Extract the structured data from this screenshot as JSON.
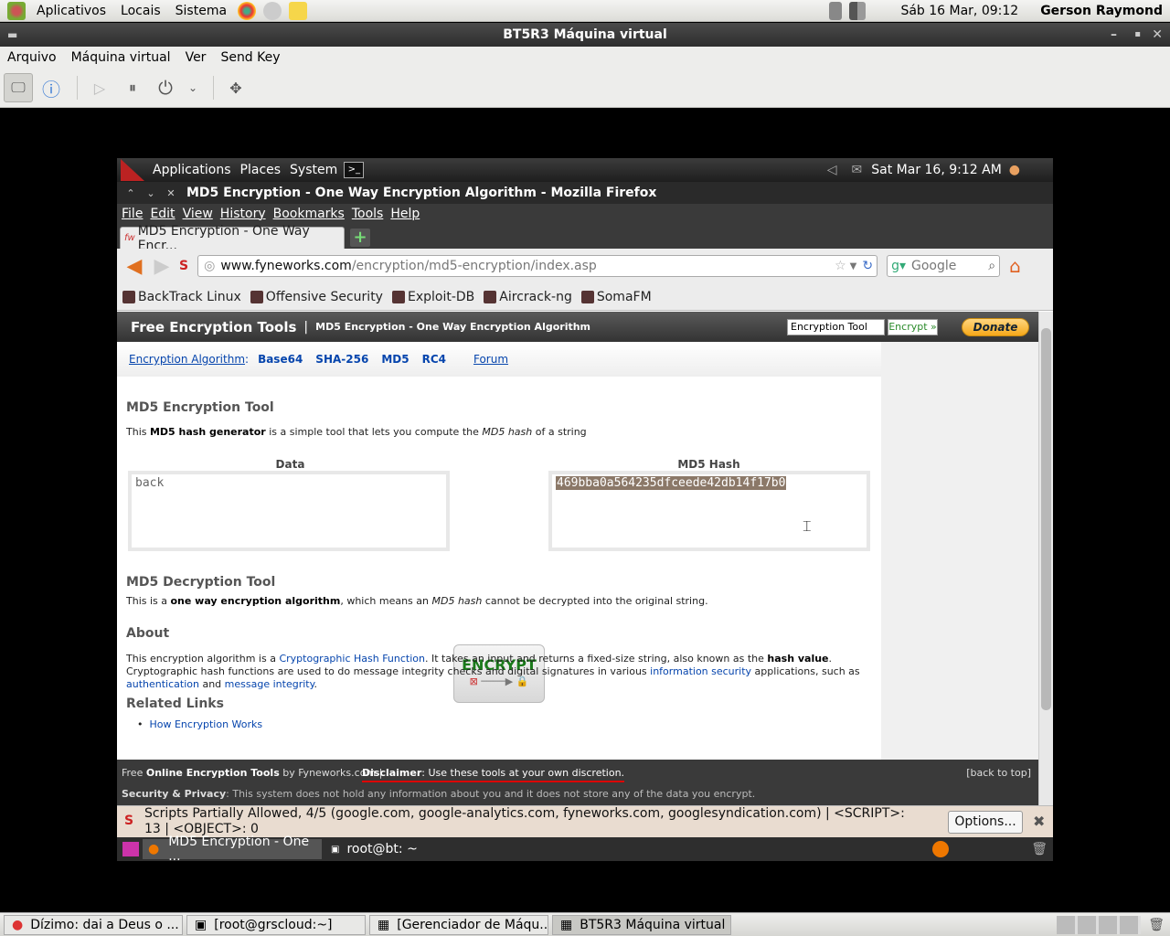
{
  "host_panel": {
    "menus": [
      "Aplicativos",
      "Locais",
      "Sistema"
    ],
    "clock": "Sáb 16 Mar, 09:12",
    "user": "Gerson Raymond"
  },
  "vbox": {
    "title": "BT5R3 Máquina virtual",
    "menus": [
      "Arquivo",
      "Máquina virtual",
      "Ver",
      "Send Key"
    ]
  },
  "guest_panel": {
    "menus": [
      "Applications",
      "Places",
      "System"
    ],
    "clock": "Sat Mar 16,  9:12 AM"
  },
  "firefox": {
    "window_title": "MD5 Encryption - One Way Encryption Algorithm - Mozilla Firefox",
    "menus": [
      "File",
      "Edit",
      "View",
      "History",
      "Bookmarks",
      "Tools",
      "Help"
    ],
    "tab_title": "MD5 Encryption - One Way Encr...",
    "url_domain": "www.fyneworks.com",
    "url_path": "/encryption/md5-encryption/index.asp",
    "search_placeholder": "Google",
    "bookmarks": [
      "BackTrack Linux",
      "Offensive Security",
      "Exploit-DB",
      "Aircrack-ng",
      "SomaFM"
    ]
  },
  "site": {
    "brand": "Free Encryption Tools",
    "divider": "|",
    "subtitle": "MD5 Encryption - One Way Encryption Algorithm",
    "search_value": "Encryption Tool",
    "encrypt_link": "Encrypt »",
    "donate": "Donate",
    "alg_label": "Encryption Algorithm",
    "alg_colon": ":",
    "algorithms": [
      "Base64",
      "SHA-256",
      "MD5",
      "RC4"
    ],
    "forum": "Forum",
    "tool_title": "MD5 Encryption Tool",
    "tool_desc_1": "This ",
    "tool_desc_b": "MD5 hash generator",
    "tool_desc_2": " is a simple tool that lets you compute the ",
    "tool_desc_i": "MD5 hash",
    "tool_desc_3": " of a string",
    "data_label": "Data",
    "data_value": "back",
    "hash_label": "MD5 Hash",
    "hash_value": "469bba0a564235dfceede42db14f17b0",
    "encrypt_button": "ENCRYPT",
    "decrypt_title": "MD5 Decryption Tool",
    "decrypt_1": "This is a ",
    "decrypt_b": "one way encryption algorithm",
    "decrypt_2": ", which means an ",
    "decrypt_i": "MD5 hash",
    "decrypt_3": " cannot be decrypted into the original string.",
    "about_title": "About",
    "about_1": "This encryption algorithm is a ",
    "about_link1": "Cryptographic Hash Function",
    "about_2": ". It takes an input and returns a fixed-size string, also known as the ",
    "about_b": "hash value",
    "about_3": ". Cryptographic hash functions are used to do message integrity checks and digital signatures in various ",
    "about_link2": "information security",
    "about_4": " applications, such as ",
    "about_link3": "authentication",
    "about_5": " and ",
    "about_link4": "message integrity",
    "about_6": ".",
    "related_title": "Related Links",
    "related_link": "How Encryption Works",
    "foot_free": "Free ",
    "foot_b": "Online Encryption Tools",
    "foot_by": " by Fyneworks.com |",
    "foot_disc_b": "Disclaimer",
    "foot_disc": ": Use these tools at your own discretion.",
    "foot_top": "[back to top]",
    "foot_sec_b": "Security & Privacy",
    "foot_sec": ": This system does not hold any information about you and it does not store any of the data you encrypt."
  },
  "noscript": {
    "message": "Scripts Partially Allowed, 4/5 (google.com, google-analytics.com, fyneworks.com, googlesyndication.com) | <SCRIPT>: 13 | <OBJECT>: 0",
    "options": "Options..."
  },
  "guest_taskbar": [
    "MD5 Encryption - One ...",
    "root@bt: ~"
  ],
  "host_taskbar": [
    "Dízimo: dai a Deus o ...",
    "[root@grscloud:~]",
    "[Gerenciador de Máqu...",
    "BT5R3 Máquina virtual"
  ]
}
